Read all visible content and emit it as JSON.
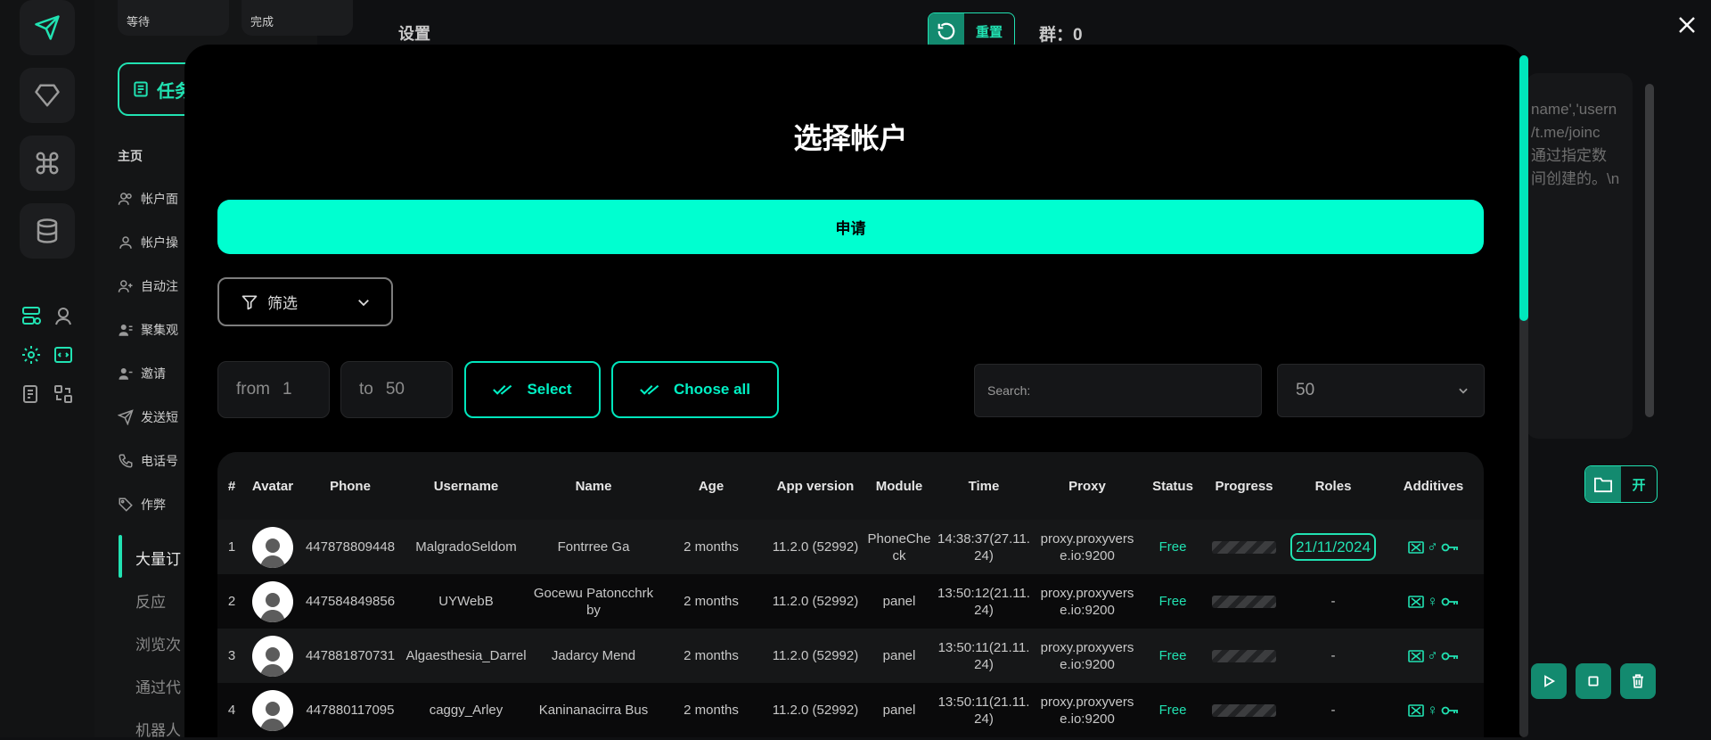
{
  "rail": {
    "icons": [
      "send-icon",
      "diamond-icon",
      "command-icon",
      "database-icon",
      "server-icon",
      "profile-icon",
      "gear-icon",
      "code-icon",
      "notes-icon",
      "swap-icon"
    ]
  },
  "sidebar": {
    "stats": [
      {
        "label": "等待"
      },
      {
        "label": "完成"
      }
    ],
    "task_button": "任务",
    "section_main": "主页",
    "items": [
      {
        "label": "帐户面"
      },
      {
        "label": "帐户操"
      },
      {
        "label": "自动注"
      },
      {
        "label": "聚集观"
      },
      {
        "label": "邀请"
      },
      {
        "label": "发送短"
      },
      {
        "label": "电话号"
      },
      {
        "label": "作弊"
      }
    ],
    "sub_items": [
      {
        "label": "大量订"
      },
      {
        "label": "反应"
      },
      {
        "label": "浏览次"
      },
      {
        "label": "通过代"
      },
      {
        "label": "机器人"
      }
    ]
  },
  "background": {
    "settings_title": "设置",
    "reset_label": "重置",
    "group_label": "群：0",
    "right_text_lines": [
      "name','usern",
      "/t.me/joinc",
      "通过指定数",
      "间创建的。\\n"
    ],
    "open_label": "开"
  },
  "modal": {
    "title": "选择帐户",
    "apply_label": "申请",
    "filter_label": "筛选",
    "from_label": "from",
    "from_value": "1",
    "to_label": "to",
    "to_value": "50",
    "select_label": "Select",
    "choose_all_label": "Choose all",
    "search_placeholder": "Search:",
    "page_size": "50",
    "columns": [
      "#",
      "Avatar",
      "Phone",
      "Username",
      "Name",
      "Age",
      "App version",
      "Module",
      "Time",
      "Proxy",
      "Status",
      "Progress",
      "Roles",
      "Additives"
    ],
    "rows": [
      {
        "num": "1",
        "phone": "447878809448",
        "username": "MalgradoSeldom",
        "name": "Fontrree Ga",
        "age": "2 months",
        "app_version": "11.2.0 (52992)",
        "module": "PhoneCheck",
        "time": "14:38:37(27.11.24)",
        "proxy": "proxy.proxyverse.io:9200",
        "status": "Free",
        "roles": "21/11/2024",
        "gender": "♂"
      },
      {
        "num": "2",
        "phone": "447584849856",
        "username": "UYWebB",
        "name": "Gocewu Patoncchrkby",
        "age": "2 months",
        "app_version": "11.2.0 (52992)",
        "module": "panel",
        "time": "13:50:12(21.11.24)",
        "proxy": "proxy.proxyverse.io:9200",
        "status": "Free",
        "roles": "-",
        "gender": "♀"
      },
      {
        "num": "3",
        "phone": "447881870731",
        "username": "Algaesthesia_Darrel",
        "name": "Jadarcy Mend",
        "age": "2 months",
        "app_version": "11.2.0 (52992)",
        "module": "panel",
        "time": "13:50:11(21.11.24)",
        "proxy": "proxy.proxyverse.io:9200",
        "status": "Free",
        "roles": "-",
        "gender": "♂"
      },
      {
        "num": "4",
        "phone": "447880117095",
        "username": "caggy_Arley",
        "name": "Kaninanacirra Bus",
        "age": "2 months",
        "app_version": "11.2.0 (52992)",
        "module": "panel",
        "time": "13:50:11(21.11.24)",
        "proxy": "proxy.proxyverse.io:9200",
        "status": "Free",
        "roles": "-",
        "gender": "♀"
      }
    ]
  },
  "colors": {
    "accent": "#00ffd0",
    "accent_dark": "#138a6f",
    "background": "#0f1012",
    "modal": "#000000"
  }
}
